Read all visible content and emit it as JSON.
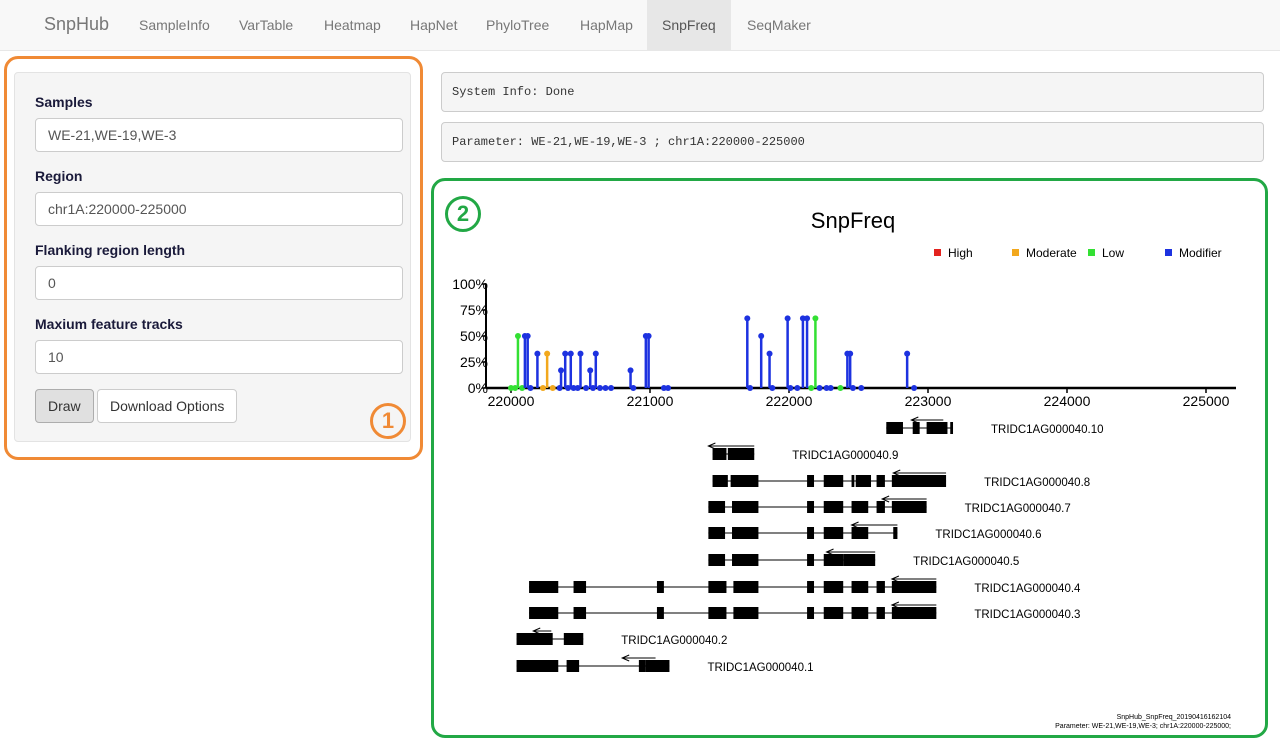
{
  "navbar": {
    "brand": "SnpHub",
    "tabs": [
      {
        "label": "SampleInfo"
      },
      {
        "label": "VarTable"
      },
      {
        "label": "Heatmap"
      },
      {
        "label": "HapNet"
      },
      {
        "label": "PhyloTree"
      },
      {
        "label": "HapMap"
      },
      {
        "label": "SnpFreq",
        "active": true
      },
      {
        "label": "SeqMaker"
      }
    ]
  },
  "sidebar": {
    "samples_label": "Samples",
    "samples_value": "WE-21,WE-19,WE-3",
    "region_label": "Region",
    "region_value": "chr1A:220000-225000",
    "flank_label": "Flanking region length",
    "flank_value": "0",
    "tracks_label": "Maxium feature tracks",
    "tracks_value": "10",
    "draw_label": "Draw",
    "download_label": "Download Options",
    "marker": "1"
  },
  "main": {
    "system_info": "System Info: Done",
    "parameter": "Parameter: WE-21,WE-19,WE-3 ; chr1A:220000-225000",
    "marker": "2"
  },
  "colors": {
    "High": "#e3231f",
    "Moderate": "#f2a81d",
    "Low": "#33e033",
    "Modifier": "#1d32e0",
    "accent_orange": "#f08a35",
    "accent_green": "#22a845"
  },
  "chart_data": {
    "type": "lollipop",
    "title": "SnpFreq",
    "legend": [
      "High",
      "Moderate",
      "Low",
      "Modifier"
    ],
    "legend_position": "top-right",
    "xlim": [
      219800,
      225200
    ],
    "ylim": [
      0,
      100
    ],
    "x_ticks": [
      "220000",
      "221000",
      "222000",
      "223000",
      "224000",
      "225000"
    ],
    "y_ticks": [
      "0%",
      "25%",
      "50%",
      "75%",
      "100%"
    ],
    "points": [
      {
        "x": 220000,
        "y": 0,
        "cat": "Low"
      },
      {
        "x": 220030,
        "y": 0,
        "cat": "Low"
      },
      {
        "x": 220050,
        "y": 50,
        "cat": "Low"
      },
      {
        "x": 220080,
        "y": 0,
        "cat": "Low"
      },
      {
        "x": 220100,
        "y": 50,
        "cat": "Modifier"
      },
      {
        "x": 220120,
        "y": 50,
        "cat": "Modifier"
      },
      {
        "x": 220140,
        "y": 0,
        "cat": "Modifier"
      },
      {
        "x": 220190,
        "y": 33,
        "cat": "Modifier"
      },
      {
        "x": 220230,
        "y": 0,
        "cat": "Moderate"
      },
      {
        "x": 220260,
        "y": 33,
        "cat": "Moderate"
      },
      {
        "x": 220300,
        "y": 0,
        "cat": "Moderate"
      },
      {
        "x": 220350,
        "y": 0,
        "cat": "Modifier"
      },
      {
        "x": 220360,
        "y": 17,
        "cat": "Modifier"
      },
      {
        "x": 220390,
        "y": 33,
        "cat": "Modifier"
      },
      {
        "x": 220410,
        "y": 0,
        "cat": "Modifier"
      },
      {
        "x": 220430,
        "y": 33,
        "cat": "Modifier"
      },
      {
        "x": 220450,
        "y": 0,
        "cat": "Modifier"
      },
      {
        "x": 220480,
        "y": 0,
        "cat": "Modifier"
      },
      {
        "x": 220500,
        "y": 33,
        "cat": "Modifier"
      },
      {
        "x": 220540,
        "y": 0,
        "cat": "Modifier"
      },
      {
        "x": 220570,
        "y": 17,
        "cat": "Modifier"
      },
      {
        "x": 220590,
        "y": 0,
        "cat": "Modifier"
      },
      {
        "x": 220610,
        "y": 33,
        "cat": "Modifier"
      },
      {
        "x": 220640,
        "y": 0,
        "cat": "Modifier"
      },
      {
        "x": 220680,
        "y": 0,
        "cat": "Modifier"
      },
      {
        "x": 220720,
        "y": 0,
        "cat": "Modifier"
      },
      {
        "x": 220860,
        "y": 17,
        "cat": "Modifier"
      },
      {
        "x": 220880,
        "y": 0,
        "cat": "Modifier"
      },
      {
        "x": 220970,
        "y": 50,
        "cat": "Modifier"
      },
      {
        "x": 220990,
        "y": 50,
        "cat": "Modifier"
      },
      {
        "x": 221100,
        "y": 0,
        "cat": "Modifier"
      },
      {
        "x": 221130,
        "y": 0,
        "cat": "Modifier"
      },
      {
        "x": 221700,
        "y": 67,
        "cat": "Modifier"
      },
      {
        "x": 221720,
        "y": 0,
        "cat": "Modifier"
      },
      {
        "x": 221800,
        "y": 50,
        "cat": "Modifier"
      },
      {
        "x": 221860,
        "y": 33,
        "cat": "Modifier"
      },
      {
        "x": 221880,
        "y": 0,
        "cat": "Modifier"
      },
      {
        "x": 221990,
        "y": 67,
        "cat": "Modifier"
      },
      {
        "x": 222010,
        "y": 0,
        "cat": "Modifier"
      },
      {
        "x": 222060,
        "y": 0,
        "cat": "Modifier"
      },
      {
        "x": 222100,
        "y": 67,
        "cat": "Modifier"
      },
      {
        "x": 222130,
        "y": 67,
        "cat": "Modifier"
      },
      {
        "x": 222160,
        "y": 0,
        "cat": "Low"
      },
      {
        "x": 222190,
        "y": 67,
        "cat": "Low"
      },
      {
        "x": 222220,
        "y": 0,
        "cat": "Modifier"
      },
      {
        "x": 222270,
        "y": 0,
        "cat": "Modifier"
      },
      {
        "x": 222300,
        "y": 0,
        "cat": "Modifier"
      },
      {
        "x": 222370,
        "y": 0,
        "cat": "Low"
      },
      {
        "x": 222420,
        "y": 33,
        "cat": "Modifier"
      },
      {
        "x": 222440,
        "y": 33,
        "cat": "Modifier"
      },
      {
        "x": 222460,
        "y": 0,
        "cat": "Modifier"
      },
      {
        "x": 222520,
        "y": 0,
        "cat": "Modifier"
      },
      {
        "x": 222850,
        "y": 33,
        "cat": "Modifier"
      },
      {
        "x": 222900,
        "y": 0,
        "cat": "Modifier"
      }
    ],
    "transcripts": [
      {
        "name": "TRIDC1AG000040.10",
        "exons": [
          [
            222700,
            222820
          ],
          [
            222890,
            222940
          ],
          [
            222990,
            223140
          ],
          [
            223160,
            223180
          ]
        ],
        "arrow": [
          223110,
          222880
        ]
      },
      {
        "name": "TRIDC1AG000040.9",
        "exons": [
          [
            221450,
            221550
          ],
          [
            221560,
            221750
          ]
        ],
        "arrow": [
          221750,
          221420
        ]
      },
      {
        "name": "TRIDC1AG000040.8",
        "exons": [
          [
            221450,
            221560
          ],
          [
            221580,
            221780
          ],
          [
            222130,
            222180
          ],
          [
            222250,
            222390
          ],
          [
            222450,
            222470
          ],
          [
            222480,
            222590
          ],
          [
            222630,
            222690
          ],
          [
            222740,
            223130
          ]
        ],
        "arrow": [
          223130,
          222750
        ]
      },
      {
        "name": "TRIDC1AG000040.7",
        "exons": [
          [
            221420,
            221540
          ],
          [
            221590,
            221780
          ],
          [
            222130,
            222180
          ],
          [
            222250,
            222390
          ],
          [
            222450,
            222570
          ],
          [
            222630,
            222690
          ],
          [
            222740,
            222990
          ]
        ],
        "arrow": [
          222990,
          222670
        ]
      },
      {
        "name": "TRIDC1AG000040.6",
        "exons": [
          [
            221420,
            221540
          ],
          [
            221590,
            221780
          ],
          [
            222130,
            222180
          ],
          [
            222250,
            222390
          ],
          [
            222450,
            222570
          ],
          [
            222750,
            222780
          ]
        ],
        "arrow": [
          222780,
          222450
        ]
      },
      {
        "name": "TRIDC1AG000040.5",
        "exons": [
          [
            221420,
            221540
          ],
          [
            221590,
            221780
          ],
          [
            222130,
            222180
          ],
          [
            222250,
            222390
          ],
          [
            222390,
            222620
          ]
        ],
        "arrow": [
          222620,
          222270
        ]
      },
      {
        "name": "TRIDC1AG000040.4",
        "exons": [
          [
            220130,
            220340
          ],
          [
            220450,
            220540
          ],
          [
            221050,
            221100
          ],
          [
            221420,
            221550
          ],
          [
            221600,
            221780
          ],
          [
            222130,
            222180
          ],
          [
            222250,
            222390
          ],
          [
            222450,
            222570
          ],
          [
            222630,
            222690
          ],
          [
            222740,
            223060
          ]
        ],
        "arrow": [
          223060,
          222740
        ]
      },
      {
        "name": "TRIDC1AG000040.3",
        "exons": [
          [
            220130,
            220340
          ],
          [
            220450,
            220540
          ],
          [
            221050,
            221100
          ],
          [
            221420,
            221550
          ],
          [
            221600,
            221780
          ],
          [
            222130,
            222180
          ],
          [
            222250,
            222390
          ],
          [
            222450,
            222570
          ],
          [
            222630,
            222690
          ],
          [
            222740,
            223060
          ]
        ],
        "arrow": [
          223060,
          222740
        ]
      },
      {
        "name": "TRIDC1AG000040.2",
        "exons": [
          [
            220040,
            220300
          ],
          [
            220380,
            220520
          ]
        ],
        "arrow": [
          220290,
          220160
        ]
      },
      {
        "name": "TRIDC1AG000040.1",
        "exons": [
          [
            220040,
            220340
          ],
          [
            220400,
            220490
          ],
          [
            220920,
            220970
          ],
          [
            220970,
            221140
          ]
        ],
        "arrow": [
          221040,
          220800
        ]
      }
    ],
    "footer_line1": "SnpHub_SnpFreq_20190416162104",
    "footer_line2": "Parameter: WE-21,WE-19,WE-3; chr1A:220000-225000;"
  }
}
